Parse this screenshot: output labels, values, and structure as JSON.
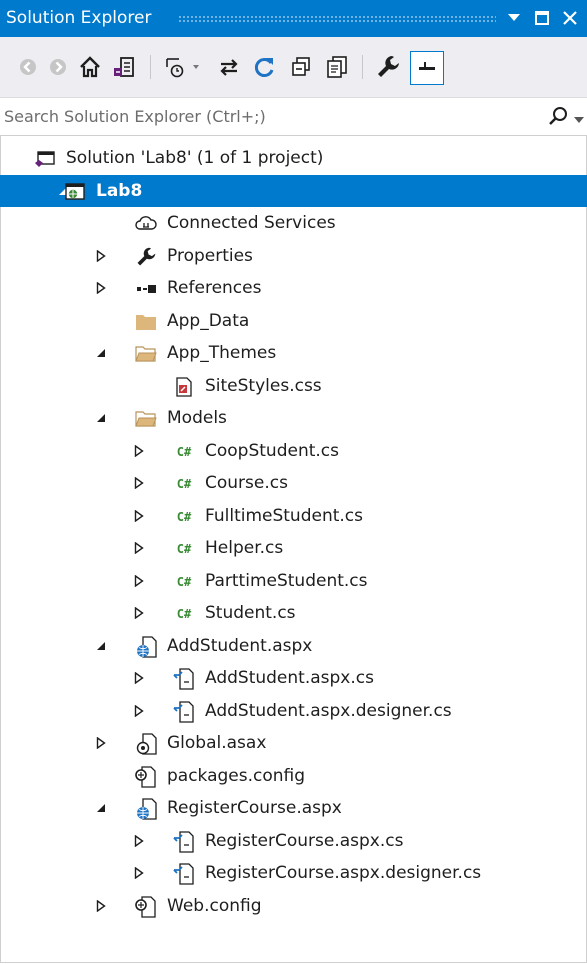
{
  "window": {
    "title": "Solution Explorer",
    "buttons": [
      "dropdown-icon",
      "maximize-icon",
      "close-icon"
    ]
  },
  "toolbar": {
    "items": [
      "back-icon",
      "forward-icon",
      "home-icon",
      "switch-views-icon",
      "pending-changes-icon",
      "sync-icon",
      "refresh-icon",
      "collapse-all-icon",
      "show-all-files-icon",
      "properties-icon",
      "preview-icon"
    ]
  },
  "search": {
    "placeholder": "Search Solution Explorer (Ctrl+;)",
    "value": ""
  },
  "tree": {
    "selected": "Lab8",
    "items": [
      {
        "label": "Solution 'Lab8' (1 of 1 project)",
        "icon": "solution-icon",
        "expander": "none"
      },
      {
        "label": "Lab8",
        "icon": "web-project-icon",
        "expander": "expanded"
      },
      {
        "label": "Connected Services",
        "icon": "connected-services-icon",
        "expander": "none"
      },
      {
        "label": "Properties",
        "icon": "wrench-icon",
        "expander": "collapsed"
      },
      {
        "label": "References",
        "icon": "references-icon",
        "expander": "collapsed"
      },
      {
        "label": "App_Data",
        "icon": "folder-icon",
        "expander": "none"
      },
      {
        "label": "App_Themes",
        "icon": "folder-open-icon",
        "expander": "expanded"
      },
      {
        "label": "SiteStyles.css",
        "icon": "css-file-icon",
        "expander": "none"
      },
      {
        "label": "Models",
        "icon": "folder-open-icon",
        "expander": "expanded"
      },
      {
        "label": "CoopStudent.cs",
        "icon": "csharp-icon",
        "expander": "collapsed"
      },
      {
        "label": "Course.cs",
        "icon": "csharp-icon",
        "expander": "collapsed"
      },
      {
        "label": "FulltimeStudent.cs",
        "icon": "csharp-icon",
        "expander": "collapsed"
      },
      {
        "label": "Helper.cs",
        "icon": "csharp-icon",
        "expander": "collapsed"
      },
      {
        "label": "ParttimeStudent.cs",
        "icon": "csharp-icon",
        "expander": "collapsed"
      },
      {
        "label": "Student.cs",
        "icon": "csharp-icon",
        "expander": "collapsed"
      },
      {
        "label": "AddStudent.aspx",
        "icon": "aspx-icon",
        "expander": "expanded"
      },
      {
        "label": "AddStudent.aspx.cs",
        "icon": "code-file-icon",
        "expander": "collapsed"
      },
      {
        "label": "AddStudent.aspx.designer.cs",
        "icon": "code-file-icon",
        "expander": "collapsed"
      },
      {
        "label": "Global.asax",
        "icon": "global-asax-icon",
        "expander": "collapsed"
      },
      {
        "label": "packages.config",
        "icon": "config-file-icon",
        "expander": "none"
      },
      {
        "label": "RegisterCourse.aspx",
        "icon": "aspx-icon",
        "expander": "expanded"
      },
      {
        "label": "RegisterCourse.aspx.cs",
        "icon": "code-file-icon",
        "expander": "collapsed"
      },
      {
        "label": "RegisterCourse.aspx.designer.cs",
        "icon": "code-file-icon",
        "expander": "collapsed"
      },
      {
        "label": "Web.config",
        "icon": "config-file-icon",
        "expander": "collapsed"
      }
    ]
  },
  "colors": {
    "accent": "#007acc",
    "toolbar_bg": "#eeeef2",
    "text": "#1e1e1e",
    "csharp_green": "#388a34",
    "folder": "#dcb67a"
  }
}
